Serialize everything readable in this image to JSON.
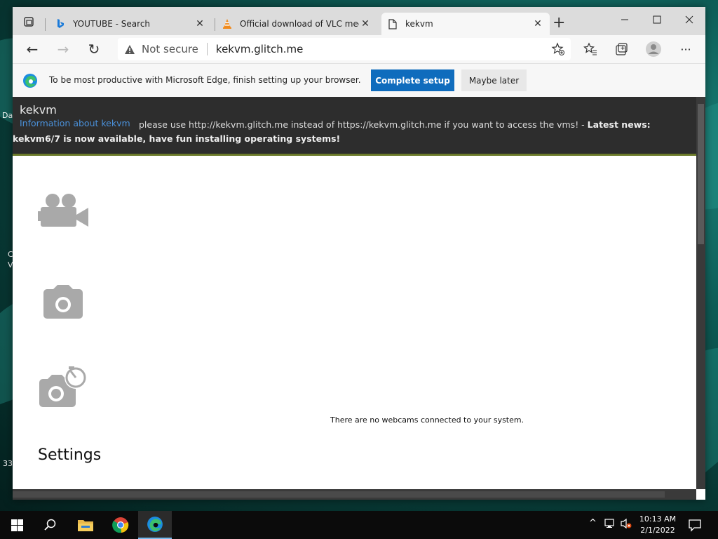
{
  "desktop": {
    "fragments": [
      "Da",
      "C",
      "V",
      "33"
    ]
  },
  "browser": {
    "tabs": [
      {
        "title": "YOUTUBE - Search",
        "icon": "bing-icon"
      },
      {
        "title": "Official download of VLC media",
        "icon": "vlc-icon"
      },
      {
        "title": "kekvm",
        "icon": "page-icon"
      }
    ],
    "close_glyph": "✕",
    "new_tab_glyph": "+",
    "window_controls": {
      "minimize": "—",
      "maximize": "☐",
      "close": "✕"
    },
    "toolbar": {
      "back": "←",
      "forward": "→",
      "refresh": "↻",
      "security_label": "Not secure",
      "url": "kekvm.glitch.me",
      "more": "···"
    },
    "infobar": {
      "message": "To be most productive with Microsoft Edge, finish setting up your browser.",
      "primary_button": "Complete setup",
      "secondary_button": "Maybe later"
    }
  },
  "page": {
    "title": "kekvm",
    "info_link": "Information about kekvm",
    "notice_text": "please use http://kekvm.glitch.me instead of https://kekvm.glitch.me if you want to access the vms! - ",
    "notice_bold": "Latest news: kekvm6/7 is now available, have fun installing operating systems!",
    "settings_label": "Settings",
    "no_webcam_message": "There are no webcams connected to your system."
  },
  "taskbar": {
    "clock_time": "10:13 AM",
    "clock_date": "2/1/2022",
    "tray_chevron": "^"
  },
  "colors": {
    "edge_blue": "#0f6cbd",
    "header_dark": "#2d2d2d",
    "link_blue": "#4a90d9",
    "taskbar": "#0b0b0b"
  }
}
